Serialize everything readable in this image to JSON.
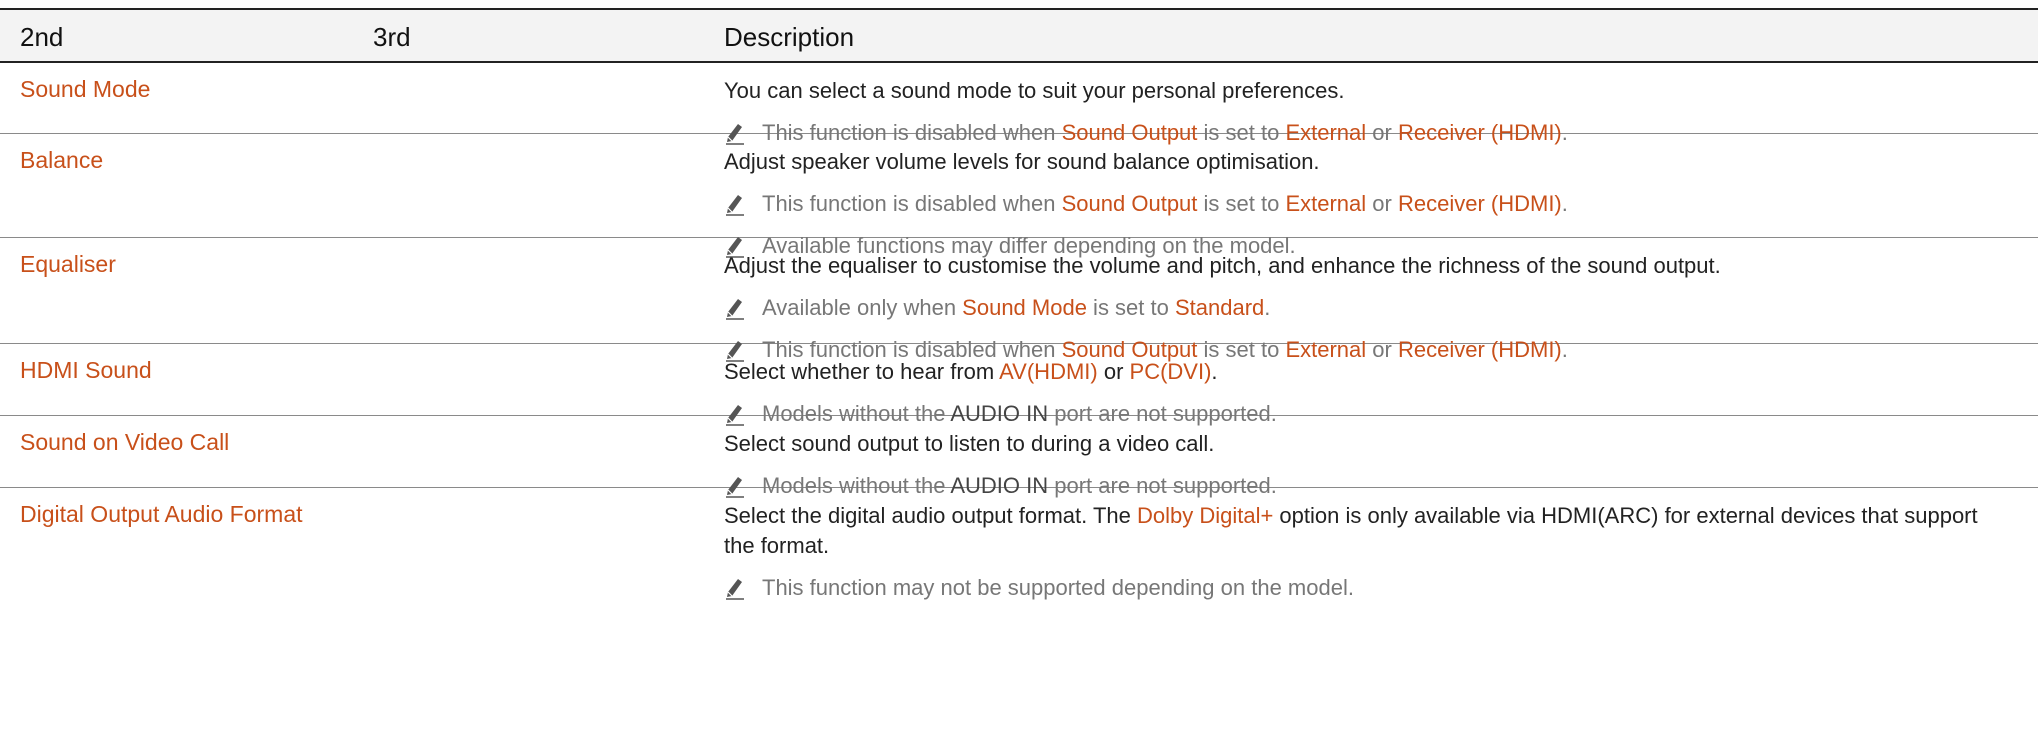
{
  "header": {
    "col1": "2nd",
    "col2": "3rd",
    "col3": "Description"
  },
  "rows": [
    {
      "name": "Sound Mode",
      "description": "You can select a sound mode to suit your personal preferences.",
      "notes": [
        {
          "t1": "This function is disabled when ",
          "k1": "Sound Output",
          "t2": " is set to ",
          "k2": "External",
          "t3": " or ",
          "k3": "Receiver (HDMI)",
          "t4": "."
        }
      ]
    },
    {
      "name": "Balance",
      "description": "Adjust speaker volume levels for sound balance optimisation.",
      "notes": [
        {
          "t1": "This function is disabled when ",
          "k1": "Sound Output",
          "t2": " is set to ",
          "k2": "External",
          "t3": " or ",
          "k3": "Receiver (HDMI)",
          "t4": "."
        },
        {
          "text": "Available functions may differ depending on the model."
        }
      ]
    },
    {
      "name": "Equaliser",
      "description": "Adjust the equaliser to customise the volume and pitch, and enhance the richness of the sound output.",
      "notes": [
        {
          "t1": "Available only when ",
          "k1": "Sound Mode",
          "t2": " is set to ",
          "k2": "Standard",
          "t3": "."
        },
        {
          "t1": "This function is disabled when ",
          "k1": "Sound Output",
          "t2": " is set to ",
          "k2": "External",
          "t3": " or ",
          "k3": "Receiver (HDMI)",
          "t4": "."
        }
      ]
    },
    {
      "name": "HDMI Sound",
      "description": {
        "t1": "Select whether to hear from ",
        "k1": "AV(HDMI)",
        "t2": " or ",
        "k2": "PC(DVI)",
        "t3": "."
      },
      "notes": [
        {
          "t1": "Models without the ",
          "k1": "AUDIO IN",
          "t2": " port are not supported."
        }
      ]
    },
    {
      "name": "Sound on Video Call",
      "description": "Select sound output to listen to during a video call.",
      "notes": [
        {
          "t1": "Models without the ",
          "k1": "AUDIO IN",
          "t2": " port are not supported."
        }
      ]
    },
    {
      "name": "Digital Output Audio Format",
      "description": {
        "t1": "Select the digital audio output format. The ",
        "k1": "Dolby Digital+",
        "t2": " option is only available via HDMI(ARC) for external devices that support the format."
      },
      "notes": [
        {
          "text": "This function may not be supported depending on the model."
        }
      ]
    }
  ],
  "colors": {
    "accent": "#c8501a",
    "note_text": "#777777",
    "rule": "#222222"
  },
  "icons": {
    "note": "pencil-note-icon"
  }
}
